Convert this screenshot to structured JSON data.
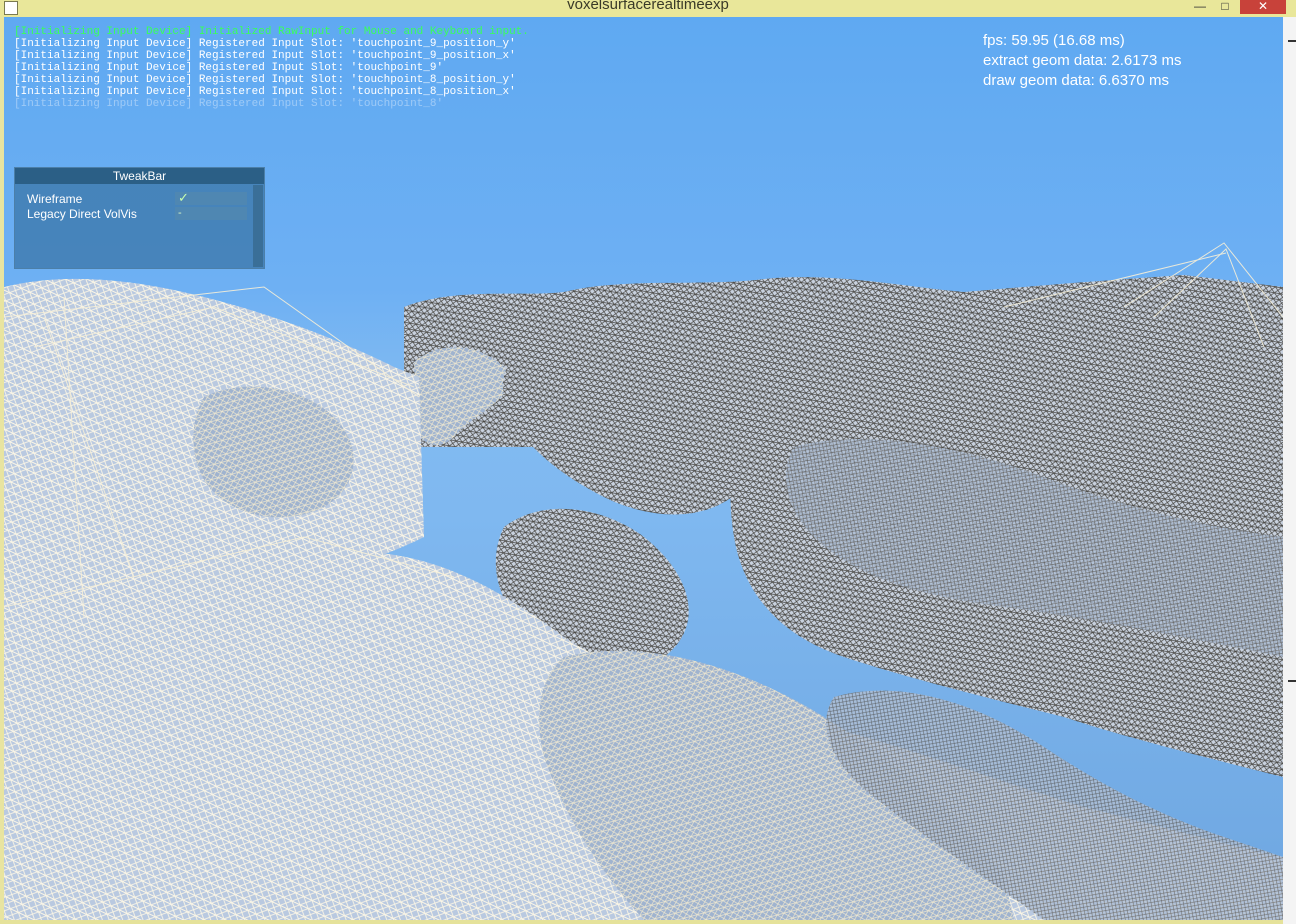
{
  "window": {
    "title": "voxelsurfacerealtimeexp",
    "minimize_glyph": "—",
    "maximize_glyph": "□",
    "close_glyph": "✕"
  },
  "console": {
    "lines": [
      "[Initializing Input Device] Initialized RawInput for Mouse and Keyboard input.",
      "[Initializing Input Device] Registered Input Slot: 'touchpoint_9_position_y'",
      "[Initializing Input Device] Registered Input Slot: 'touchpoint_9_position_x'",
      "[Initializing Input Device] Registered Input Slot: 'touchpoint_9'",
      "[Initializing Input Device] Registered Input Slot: 'touchpoint_8_position_y'",
      "[Initializing Input Device] Registered Input Slot: 'touchpoint_8_position_x'",
      "[Initializing Input Device] Registered Input Slot: 'touchpoint_8'"
    ]
  },
  "stats": {
    "fps": "fps: 59.95 (16.68 ms)",
    "extract": "extract geom data: 2.6173 ms",
    "draw": "draw geom data: 6.6370 ms"
  },
  "tweakbar": {
    "title": "TweakBar",
    "rows": [
      {
        "label": "Wireframe",
        "value": "✓"
      },
      {
        "label": "Legacy Direct VolVis",
        "value": "-"
      }
    ]
  },
  "colors": {
    "sky_top": "#5fa9f2",
    "mesh_light": "#f3ecd4",
    "mesh_dark": "#4a4844",
    "console_highlight": "#39ff5a"
  }
}
